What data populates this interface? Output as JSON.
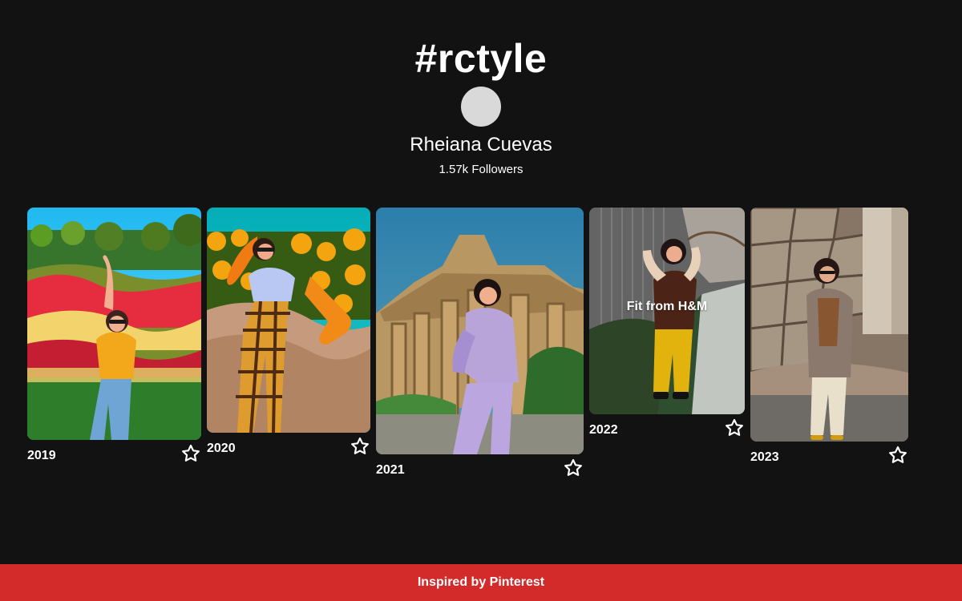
{
  "header": {
    "title": "#rctyle",
    "profile_name": "Rheiana Cuevas",
    "followers": "1.57k Followers"
  },
  "cards": [
    {
      "year": "2019",
      "icon": "star-outline-icon"
    },
    {
      "year": "2020",
      "icon": "star-outline-icon"
    },
    {
      "year": "2021",
      "icon": "star-outline-icon"
    },
    {
      "year": "2022",
      "overlay": "Fit from H&M",
      "icon": "star-outline-icon"
    },
    {
      "year": "2023",
      "icon": "star-outline-icon"
    }
  ],
  "footer": {
    "text": "Inspired by Pinterest"
  },
  "colors": {
    "background": "#121212",
    "footer": "#d32a2a",
    "avatar": "#d9d9d9",
    "text": "#ffffff"
  }
}
